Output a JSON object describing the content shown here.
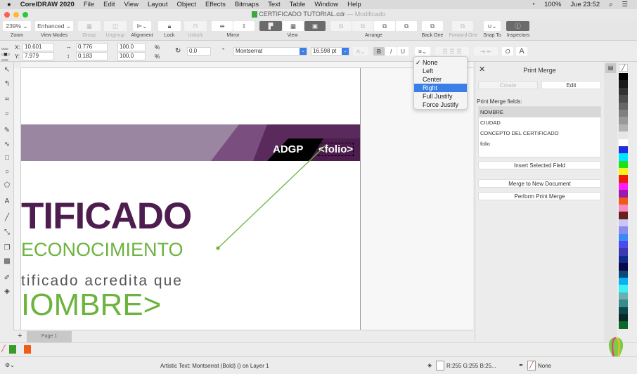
{
  "menubar": {
    "app": "CorelDRAW 2020",
    "items": [
      "File",
      "Edit",
      "View",
      "Layout",
      "Object",
      "Effects",
      "Bitmaps",
      "Text",
      "Table",
      "Window",
      "Help"
    ],
    "battery": "100%",
    "clock": "Jue 23:52"
  },
  "titlebar": {
    "title": "CERTIFICADO TUTORIAL.cdr",
    "state": "— Modificado"
  },
  "toolbar": {
    "zoom": "239%",
    "view_mode": "Enhanced",
    "labels": {
      "zoom": "Zoom",
      "view_modes": "View Modes",
      "group": "Group",
      "ungroup": "Ungroup",
      "alignment": "Alignment",
      "lock": "Lock",
      "unlock": "Unlock",
      "mirror": "Mirror",
      "view": "View",
      "arrange": "Arrange",
      "back_one": "Back One",
      "forward_one": "Forward One",
      "snap_to": "Snap To",
      "inspectors": "Inspectors"
    }
  },
  "propbar": {
    "x_label": "X:",
    "x": "10.601",
    "y_label": "Y:",
    "y": "7.979",
    "w": "0.776",
    "h": "0.183",
    "sx": "100.0",
    "sy": "100.0",
    "pct": "%",
    "rotation": "0.0",
    "deg": "°",
    "font": "Montserrat",
    "size": "16.598 pt",
    "bold": "B",
    "italic": "I",
    "underline": "U"
  },
  "align_menu": {
    "items": [
      "None",
      "Left",
      "Center",
      "Right",
      "Full Justify",
      "Force Justify"
    ],
    "checked": "None",
    "highlighted": "Right"
  },
  "document": {
    "folio_prefix": "ADGP",
    "folio": "<folio>",
    "title": "TIFICADO",
    "subtitle": "ECONOCIMIENTO",
    "line": "tificado acredita que",
    "name": "IOMBRE>"
  },
  "docker": {
    "title": "Print Merge",
    "create": "Create",
    "edit": "Edit",
    "fields_label": "Print Merge fields:",
    "fields": [
      "NOMBRE",
      "CIUDAD",
      "CONCEPTO DEL CERTIFICADO",
      "folio"
    ],
    "insert": "Insert Selected Field",
    "merge_new": "Merge to New Document",
    "perform": "Perform Print Merge"
  },
  "pagetabs": {
    "add": "+",
    "page": "Page 1"
  },
  "status": {
    "object": "Artistic Text: Montserrat (Bold) () on Layer 1",
    "fill": "R:255 G:255 B:25...",
    "outline": "None"
  },
  "palette": [
    "#000000",
    "#1a1a1a",
    "#333333",
    "#4d4d4d",
    "#666666",
    "#808080",
    "#999999",
    "#b3b3b3",
    "#e6e6e6",
    "#ffffff",
    "#1f2ce0",
    "#00e5ff",
    "#1fe01f",
    "#f5f51a",
    "#f01a0a",
    "#ff1aff",
    "#9a1ab0",
    "#f05a14",
    "#f58ac0",
    "#6b1f1f",
    "#c8c8f8",
    "#8a8af0",
    "#3a8af5",
    "#4a4af0",
    "#3a3ab0",
    "#0f2a8a",
    "#0a0a4a",
    "#0a4a7a",
    "#0ab0f0",
    "#3af0f5",
    "#6ab0b0",
    "#3a8a8a",
    "#0a4a4a",
    "#0a2a2a",
    "#0a6a2a"
  ],
  "colors": {
    "purple": "#4e1d4f",
    "green": "#6cb33f",
    "band": "#9a86a0",
    "accent": "#3a7ee8"
  }
}
